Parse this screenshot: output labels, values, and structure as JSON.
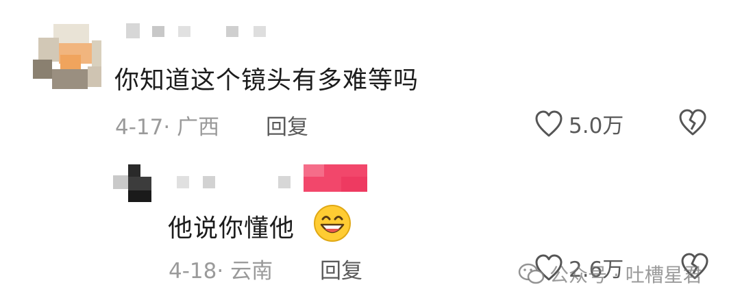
{
  "comments": [
    {
      "text": "你知道这个镜头有多难等吗",
      "date_location": "4-17· 广西",
      "reply_label": "回复",
      "likes": "5.0万"
    },
    {
      "text": "他说你懂他",
      "emoji": "grinning-face-emoji",
      "date_location": "4-18· 云南",
      "reply_label": "回复",
      "likes": "2.6万"
    }
  ],
  "watermark": {
    "text": "公众号 · 吐槽星君",
    "icon": "wechat-icon"
  },
  "colors": {
    "text": "#1c1c1c",
    "meta": "#9a9a9a",
    "action": "#5a5a5a",
    "badge": "#f2476b"
  }
}
